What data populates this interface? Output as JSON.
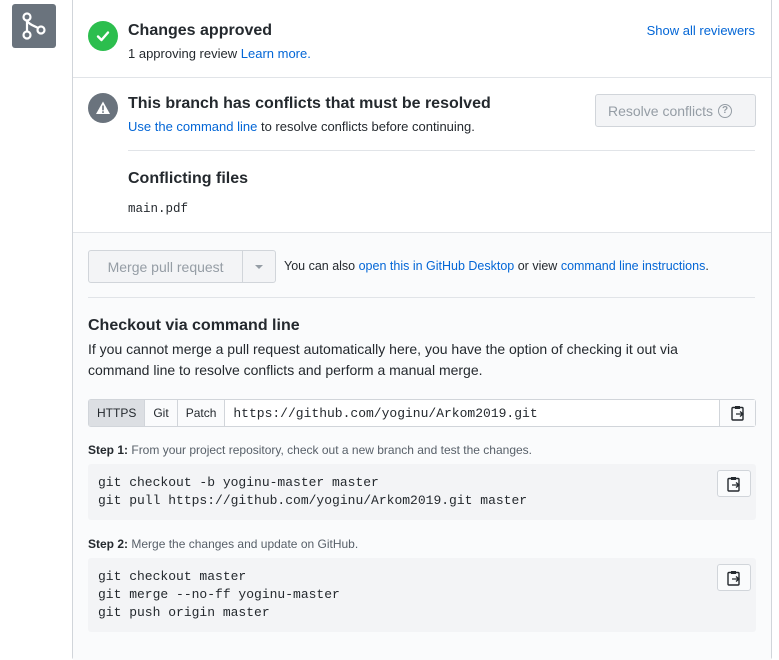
{
  "approved": {
    "title": "Changes approved",
    "review_text": "1 approving review",
    "learn_more": "Learn more.",
    "show_reviewers": "Show all reviewers"
  },
  "conflict": {
    "title": "This branch has conflicts that must be resolved",
    "link_text": "Use the command line",
    "rest_text": "to resolve conflicts before continuing.",
    "resolve_button": "Resolve conflicts",
    "resolve_help": "?",
    "files_title": "Conflicting files",
    "files": [
      "main.pdf"
    ]
  },
  "merge": {
    "button_label": "Merge pull request",
    "also_text": "You can also",
    "desktop_link": "open this in GitHub Desktop",
    "or_view": "or view",
    "cli_link": "command line instructions",
    "period": "."
  },
  "checkout": {
    "title": "Checkout via command line",
    "description": "If you cannot merge a pull request automatically here, you have the option of checking it out via command line to resolve conflicts and perform a manual merge.",
    "protocols": [
      "HTTPS",
      "Git",
      "Patch"
    ],
    "selected_protocol": "HTTPS",
    "url": "https://github.com/yoginu/Arkom2019.git",
    "step1_label": "Step 1:",
    "step1_text": "From your project repository, check out a new branch and test the changes.",
    "step1_code": [
      "git checkout -b yoginu-master master",
      "git pull https://github.com/yoginu/Arkom2019.git master"
    ],
    "step2_label": "Step 2:",
    "step2_text": "Merge the changes and update on GitHub.",
    "step2_code": [
      "git checkout master",
      "git merge --no-ff yoginu-master",
      "git push origin master"
    ]
  },
  "colors": {
    "success": "#2cbe4e",
    "neutral": "#6a737d",
    "link": "#0366d6"
  }
}
